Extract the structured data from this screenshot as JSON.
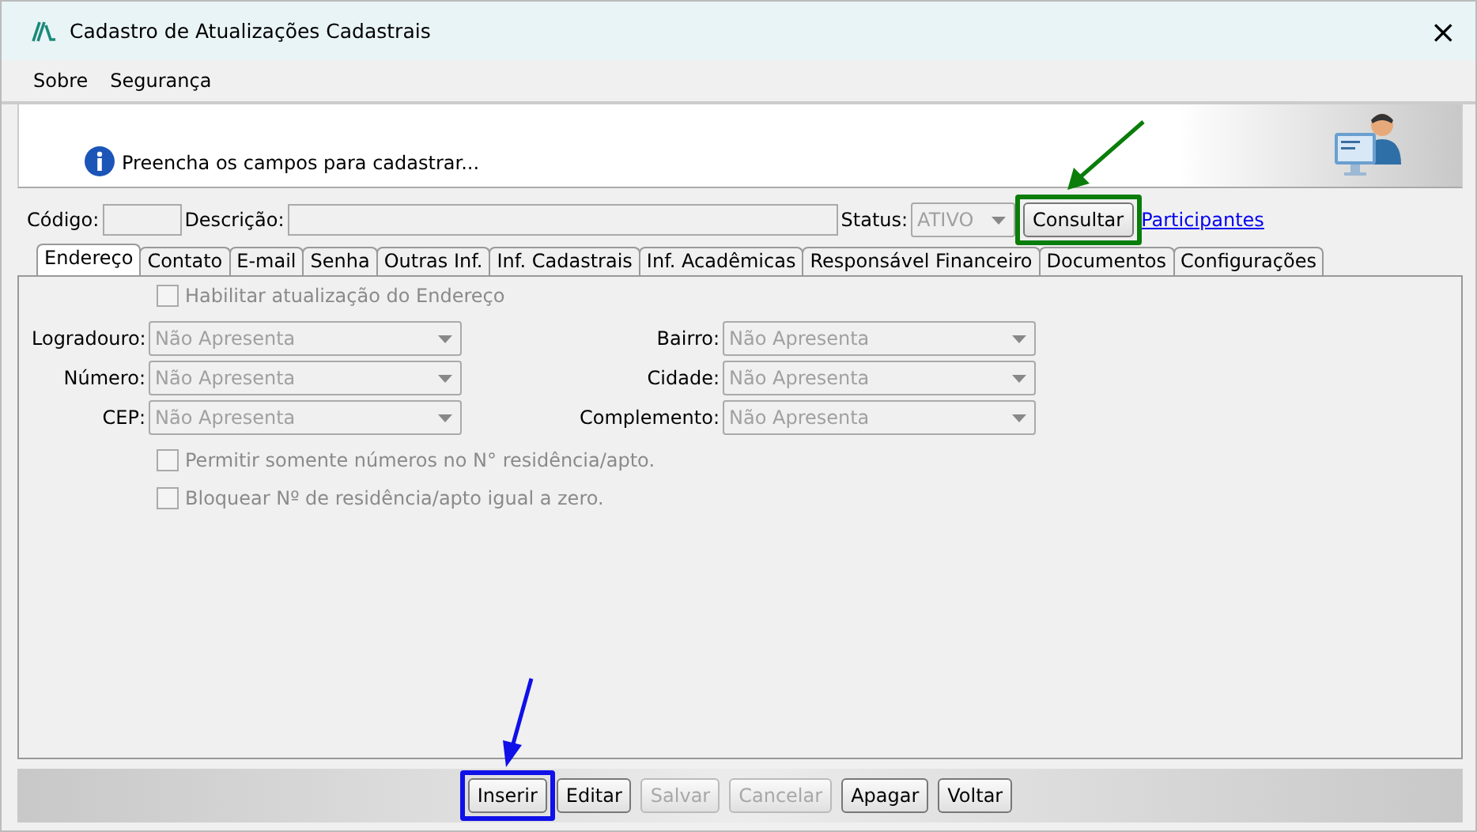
{
  "window": {
    "title": "Cadastro de Atualizações Cadastrais",
    "close": "×"
  },
  "menu": [
    "Sobre",
    "Segurança"
  ],
  "header": {
    "message": "Preencha os campos para cadastrar..."
  },
  "form": {
    "codigo_label": "Código:",
    "descricao_label": "Descrição:",
    "status_label": "Status:",
    "status_value": "ATIVO",
    "status_disabled": true,
    "consultar": {
      "label": "Consultar",
      "highlighted": true,
      "color": "#0a7d0a"
    },
    "link": "Participantes"
  },
  "tabs": [
    {
      "label": "Endereço",
      "selected": true
    },
    {
      "label": "Contato",
      "selected": false
    },
    {
      "label": "E-mail",
      "selected": false
    },
    {
      "label": "Senha",
      "selected": false
    },
    {
      "label": "Outras Inf.",
      "selected": false
    },
    {
      "label": "Inf. Cadastrais",
      "selected": false
    },
    {
      "label": "Inf. Acadêmicas",
      "selected": false
    },
    {
      "label": "Responsável Financeiro",
      "selected": false
    },
    {
      "label": "Documentos",
      "selected": false
    },
    {
      "label": "Configurações",
      "selected": false
    }
  ],
  "enable_checkbox": {
    "label": "Habilitar atualização do Endereço",
    "checked": false
  },
  "fields": [
    {
      "label": "Logradouro:",
      "value": "Não Apresenta"
    },
    {
      "label": "Bairro:",
      "value": "Não Apresenta"
    },
    {
      "label": "Número:",
      "value": "Não Apresenta"
    },
    {
      "label": "Cidade:",
      "value": "Não Apresenta"
    },
    {
      "label": "CEP:",
      "value": "Não Apresenta"
    },
    {
      "label": "Complemento:",
      "value": "Não Apresenta"
    }
  ],
  "options": [
    {
      "label": "Permitir somente números no N° residência/apto.",
      "checked": false
    },
    {
      "label": "Bloquear Nº de residência/apto igual a zero.",
      "checked": false
    }
  ],
  "buttons": [
    {
      "label": "Inserir",
      "disabled": false,
      "highlighted": true,
      "color": "#1010e8"
    },
    {
      "label": "Editar",
      "disabled": false
    },
    {
      "label": "Salvar",
      "disabled": true
    },
    {
      "label": "Cancelar",
      "disabled": true
    },
    {
      "label": "Apagar",
      "disabled": false
    },
    {
      "label": "Voltar",
      "disabled": false
    }
  ]
}
